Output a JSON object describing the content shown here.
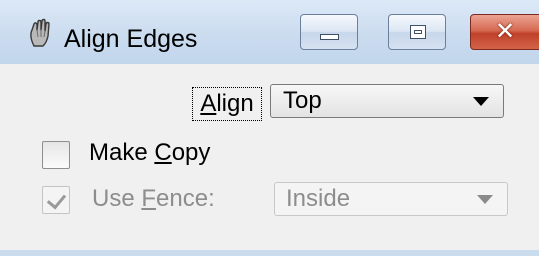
{
  "window": {
    "title": "Align Edges",
    "icon": "microstation-hand-icon",
    "buttons": {
      "minimize": "minimize-icon",
      "maximize": "maximize-icon",
      "close": "close-icon"
    }
  },
  "align": {
    "label_prefix": "",
    "label_underlined": "A",
    "label_rest": "lign",
    "value": "Top"
  },
  "make_copy": {
    "label_prefix": "Make ",
    "label_underlined": "C",
    "label_rest": "opy",
    "checked": false
  },
  "use_fence": {
    "label_prefix": "Use ",
    "label_underlined": "F",
    "label_rest": "ence:",
    "checked": true,
    "enabled": false,
    "value": "Inside"
  }
}
